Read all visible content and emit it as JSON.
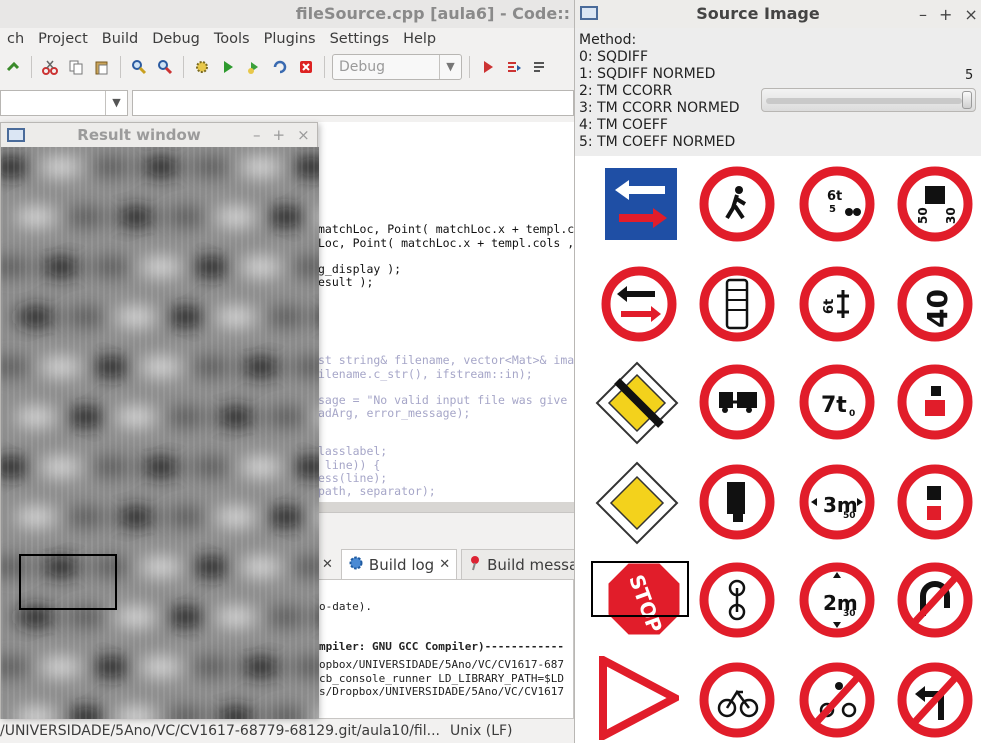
{
  "ide": {
    "title": "fileSource.cpp [aula6] - Code::",
    "menu": [
      "ch",
      "Project",
      "Build",
      "Debug",
      "Tools",
      "Plugins",
      "Settings",
      "Help"
    ],
    "build_target": "Debug",
    "code_lines": [
      {
        "text": "matchLoc, Point( matchLoc.x + templ.c",
        "faded": false
      },
      {
        "text": "Loc, Point( matchLoc.x + templ.cols ,",
        "faded": false
      },
      {
        "text": "g_display );",
        "faded": false
      },
      {
        "text": "esult );",
        "faded": false
      },
      {
        "text": "st string& filename, vector<Mat>& ima",
        "faded": true
      },
      {
        "text": "ilename.c_str(), ifstream::in);",
        "faded": true
      },
      {
        "text": "sage = \"No valid input file was give",
        "faded": true
      },
      {
        "text": "adArg, error_message);",
        "faded": true
      },
      {
        "text": "lasslabel;",
        "faded": true
      },
      {
        "text": " line)) {",
        "faded": true
      },
      {
        "text": "ess(line);",
        "faded": true
      },
      {
        "text": "path, separator);",
        "faded": true
      }
    ],
    "bottom_tabs": [
      {
        "label": "Build log"
      },
      {
        "label": "Build message"
      }
    ],
    "log_lines": [
      {
        "text": "o-date).",
        "bold": false
      },
      {
        "text": "mpiler: GNU GCC Compiler)------------",
        "bold": true
      },
      {
        "text": "opbox/UNIVERSIDADE/5Ano/VC/CV1617-687",
        "bold": false
      },
      {
        "text": "cb_console_runner LD_LIBRARY_PATH=$LD",
        "bold": false
      },
      {
        "text": "s/Dropbox/UNIVERSIDADE/5Ano/VC/CV1617",
        "bold": false
      }
    ],
    "status_path": "/UNIVERSIDADE/5Ano/VC/CV1617-68779-68129.git/aula10/fil...",
    "status_eol": "Unix (LF)"
  },
  "result_window": {
    "title": "Result window",
    "controls": [
      "–",
      "+",
      "×"
    ]
  },
  "source_window": {
    "title": "Source Image",
    "controls": [
      "–",
      "+",
      "×"
    ],
    "method_header": "Method:",
    "methods": [
      "0: SQDIFF",
      "1: SQDIFF NORMED",
      "2: TM CCORR",
      "3: TM CCORR NORMED",
      "4: TM COEFF",
      "5: TM COEFF NORMED"
    ],
    "trackbar_value": "5",
    "trackbar_fraction": 1.0,
    "sign_texts": {
      "s3": "6t",
      "s3b": "5",
      "s4a": "50",
      "s4b": "30",
      "s8": "6t",
      "s9": "40",
      "s11": "7t",
      "s11b": "0",
      "s15": "3m",
      "s15b": "50",
      "s18": "STOP",
      "s20": "2m",
      "s20b": "30"
    }
  },
  "colors": {
    "sign_red": "#e11d2a",
    "sign_blue": "#1f4fa5",
    "priority_yellow": "#f3d21c"
  }
}
